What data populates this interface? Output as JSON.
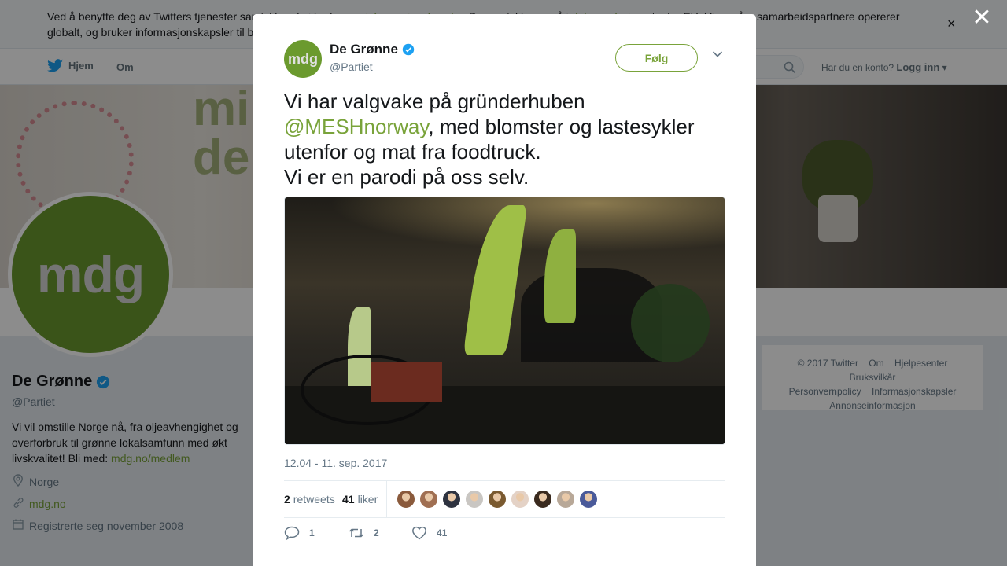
{
  "cookie": {
    "line1_pre": "Ved å benytte deg av Twitters tjenester samtykker du i bruken av ",
    "link1": "informasjonskapsler",
    "line1_mid": ". Du samtykker også i ",
    "link2": "dataoverføring",
    "line1_post": " utenfor EU. Vi og våre samarbeidspartnere opererer",
    "line2": "globalt, og bruker informasjonskapsler til b",
    "close": "×"
  },
  "nav": {
    "home": "Hjem",
    "about": "Om",
    "login_question": "Har du en konto?",
    "login": "Logg inn"
  },
  "banner": {
    "word": "mi\nde"
  },
  "profile": {
    "avatar_text": "mdg",
    "name": "De Grønne",
    "handle": "@Partiet",
    "bio_text": "Vi vil omstille Norge nå, fra oljeavhengighet og overforbruk til grønne lokalsamfunn med økt livskvalitet! Bli med: ",
    "bio_link": "mdg.no/medlem",
    "location": "Norge",
    "website": "mdg.no",
    "joined": "Registrerte seg november 2008"
  },
  "footer": {
    "items": [
      "© 2017 Twitter",
      "Om",
      "Hjelpesenter",
      "Bruksvilkår",
      "Personvernpolicy",
      "Informasjonskapsler",
      "Annonseinformasjon"
    ]
  },
  "overlay": {
    "close": "✕"
  },
  "tweet": {
    "avatar_text": "mdg",
    "name": "De Grønne",
    "handle": "@Partiet",
    "follow": "Følg",
    "text_part1": "Vi har valgvake på gründerhuben ",
    "mention": "@MESHnorway",
    "text_part2": ", med blomster og lastesykler utenfor og mat fra foodtruck.",
    "text_line2": "Vi er en parodi på oss selv.",
    "timestamp": "12.04 - 11. sep. 2017",
    "retweets_count": "2",
    "retweets_label": "retweets",
    "likes_count": "41",
    "likes_label": "liker",
    "liker_colors": [
      "#8a5a3c",
      "#a06f52",
      "#2e3340",
      "#c9c6c2",
      "#7a5a30",
      "#e4d2c6",
      "#3a2a1e",
      "#b8a898",
      "#4a5a9a"
    ],
    "reply_count": "1",
    "retweet_count": "2",
    "like_count": "41"
  },
  "colors": {
    "accent": "#79a33a",
    "verified": "#1da1f2",
    "twitter_blue": "#1da1f2"
  }
}
